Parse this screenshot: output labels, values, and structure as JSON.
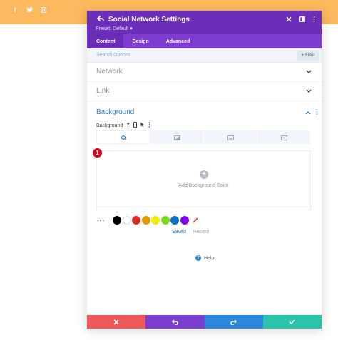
{
  "social_icons": [
    "f",
    "t",
    "ig"
  ],
  "modal": {
    "title": "Social Network Settings",
    "preset": "Preset: Default ▾",
    "tabs": [
      {
        "label": "Content",
        "active": true
      },
      {
        "label": "Design",
        "active": false
      },
      {
        "label": "Advanced",
        "active": false
      }
    ],
    "search_placeholder": "Search Options",
    "filter_label": "Filter",
    "sections": [
      {
        "label": "Network"
      },
      {
        "label": "Link"
      }
    ],
    "background": {
      "title": "Background",
      "field_label": "Background",
      "type_tabs": [
        "color-fill-icon",
        "gradient-icon",
        "image-icon",
        "video-icon"
      ],
      "add_label": "Add Background Color",
      "badge": "1",
      "swatches": [
        "#000000",
        "#ffffff",
        "#e02b20",
        "#e09900",
        "#edf000",
        "#7cda24",
        "#0c71c3",
        "#8300e9"
      ],
      "saved_label": "Saved",
      "recent_label": "Recent"
    },
    "help_label": "Help"
  },
  "colors": {
    "header": "#6c2eb9",
    "tabs": "#7e3bd0",
    "accent": "#2e82c2",
    "footer_cancel": "#ee5a5a",
    "footer_undo": "#7a3ed0",
    "footer_redo": "#2b87da",
    "footer_save": "#29c4a9"
  }
}
